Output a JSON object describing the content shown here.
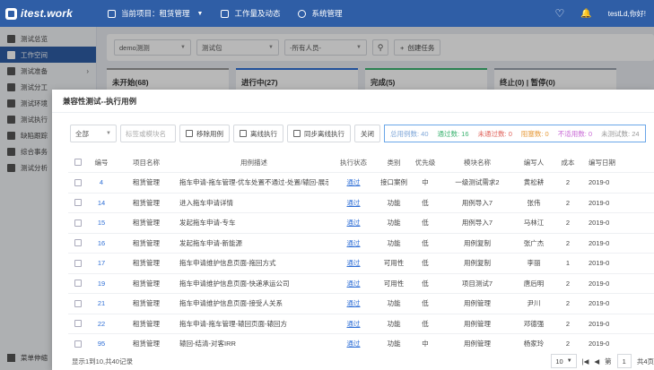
{
  "topbar": {
    "logo": "itest.work",
    "project_label": "当前项目：租赁管理",
    "workload_label": "工作量及动态",
    "system_label": "系统管理",
    "user_label": "testLd,你好!"
  },
  "sidebar": {
    "items": [
      {
        "label": "测试总览"
      },
      {
        "label": "工作空间"
      },
      {
        "label": "测试准备"
      },
      {
        "label": "测试分工"
      },
      {
        "label": "测试环境"
      },
      {
        "label": "测试执行"
      },
      {
        "label": "缺陷跟踪"
      },
      {
        "label": "综合事务"
      },
      {
        "label": "测试分析"
      }
    ],
    "footer": "菜单伸缩"
  },
  "filterbar": {
    "task_select": "demo测测",
    "package_select": "测试包",
    "people_select": "-所有人员-",
    "create_task": "创建任务"
  },
  "columns": [
    {
      "label": "未开始(68)"
    },
    {
      "label": "进行中(27)"
    },
    {
      "label": "完成(5)"
    },
    {
      "label": "终止(0) | 暂停(0)"
    }
  ],
  "dialog": {
    "title": "兼容性测试--执行用例",
    "scope_select": "全部",
    "search_placeholder": "标签或模块名",
    "btn_remove": "移除用例",
    "btn_offline": "离线执行",
    "btn_sync": "同步离线执行",
    "btn_close": "关闭",
    "stats": {
      "total": "总用例数: 40",
      "pass": "通过数: 16",
      "notpass": "未通过数: 0",
      "block": "阻塞数: 0",
      "na": "不适用数: 0",
      "notrun": "未测试数: 24"
    },
    "headers": {
      "no": "编号",
      "item": "项目名称",
      "desc": "用例描述",
      "status": "执行状态",
      "type": "类别",
      "pri": "优先级",
      "mod": "模块名称",
      "author": "编写人",
      "cost": "成本",
      "date": "编写日期"
    },
    "rows": [
      {
        "no": "4",
        "item": "租赁管理",
        "desc": "拖车申请-拖车管理-优车处置不通过-处置/辕回-展示",
        "status": "通过",
        "type": "接口案例",
        "pri": "中",
        "mod": "一级测试需求2",
        "author": "黄松耕",
        "cost": "2",
        "date": "2019-0"
      },
      {
        "no": "14",
        "item": "租赁管理",
        "desc": "进入拖车申请详情",
        "status": "通过",
        "type": "功能",
        "pri": "低",
        "mod": "用例导入7",
        "author": "张伟",
        "cost": "2",
        "date": "2019-0"
      },
      {
        "no": "15",
        "item": "租赁管理",
        "desc": "发起拖车申请-专车",
        "status": "通过",
        "type": "功能",
        "pri": "低",
        "mod": "用例导入7",
        "author": "马林江",
        "cost": "2",
        "date": "2019-0"
      },
      {
        "no": "16",
        "item": "租赁管理",
        "desc": "发起拖车申请-新能源",
        "status": "通过",
        "type": "功能",
        "pri": "低",
        "mod": "用例复制",
        "author": "张广杰",
        "cost": "2",
        "date": "2019-0"
      },
      {
        "no": "17",
        "item": "租赁管理",
        "desc": "拖车申请维护信息页面-拖回方式",
        "status": "通过",
        "type": "可用性",
        "pri": "低",
        "mod": "用例复制",
        "author": "李丽",
        "cost": "1",
        "date": "2019-0"
      },
      {
        "no": "19",
        "item": "租赁管理",
        "desc": "拖车申请维护信息页面-快递承运公司",
        "status": "通过",
        "type": "可用性",
        "pri": "低",
        "mod": "项目测试7",
        "author": "唐后明",
        "cost": "2",
        "date": "2019-0"
      },
      {
        "no": "21",
        "item": "租赁管理",
        "desc": "拖车申请维护信息页面-接受人关系",
        "status": "通过",
        "type": "功能",
        "pri": "低",
        "mod": "用例管理",
        "author": "尹川",
        "cost": "2",
        "date": "2019-0"
      },
      {
        "no": "22",
        "item": "租赁管理",
        "desc": "拖车申请-拖车管理-辕回页面-辕回方",
        "status": "通过",
        "type": "功能",
        "pri": "低",
        "mod": "用例管理",
        "author": "邓德强",
        "cost": "2",
        "date": "2019-0"
      },
      {
        "no": "95",
        "item": "租赁管理",
        "desc": "辕回-结清-对客IRR",
        "status": "通过",
        "type": "功能",
        "pri": "中",
        "mod": "用例管理",
        "author": "杨家玲",
        "cost": "2",
        "date": "2019-0"
      }
    ],
    "footer": "显示1到10,共40记录",
    "pager": {
      "size": "10",
      "first": "|◀",
      "prev": "◀",
      "page": "第",
      "page_no": "1",
      "total": "共4页"
    }
  }
}
